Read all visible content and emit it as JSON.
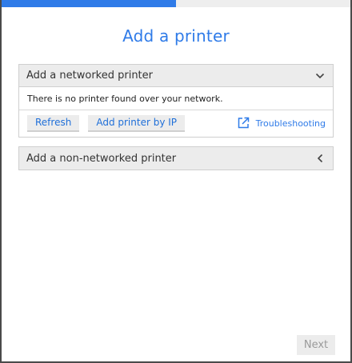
{
  "progress": {
    "fraction": 0.5
  },
  "colors": {
    "accent": "#2f7be8",
    "header_bg": "#ececec",
    "border": "#cfcfcf"
  },
  "title": "Add a printer",
  "networked": {
    "header": "Add a networked printer",
    "expanded_icon": "chevron-down-icon",
    "message": "There is no printer found over your network.",
    "refresh_label": "Refresh",
    "add_by_ip_label": "Add printer by IP",
    "troubleshooting_icon": "external-link-icon",
    "troubleshooting_label": "Troubleshooting"
  },
  "non_networked": {
    "header": "Add a non-networked printer",
    "collapsed_icon": "chevron-left-icon"
  },
  "footer": {
    "next_label": "Next"
  }
}
